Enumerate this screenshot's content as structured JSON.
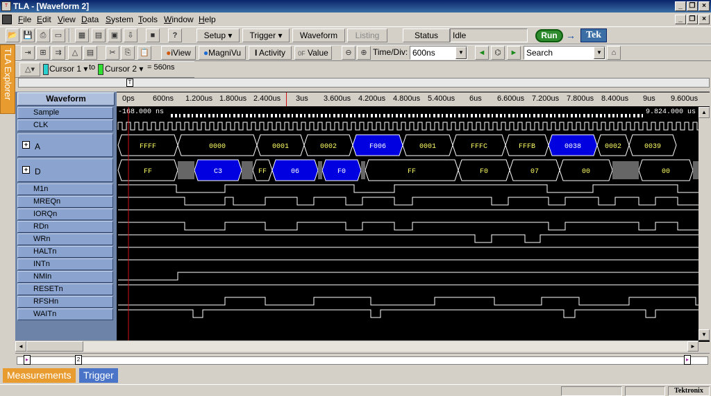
{
  "window": {
    "title": "TLA - [Waveform 2]"
  },
  "menu": [
    {
      "label": "File",
      "u": "F",
      "rest": "ile"
    },
    {
      "label": "Edit",
      "u": "E",
      "rest": "dit"
    },
    {
      "label": "View",
      "u": "V",
      "rest": "iew"
    },
    {
      "label": "Data",
      "u": "D",
      "rest": "ata"
    },
    {
      "label": "System",
      "u": "S",
      "rest": "ystem"
    },
    {
      "label": "Tools",
      "u": "T",
      "rest": "ools"
    },
    {
      "label": "Window",
      "u": "W",
      "rest": "indow"
    },
    {
      "label": "Help",
      "u": "H",
      "rest": "elp"
    }
  ],
  "toolbar1": {
    "setup": "Setup",
    "trigger": "Trigger",
    "waveform": "Waveform",
    "listing": "Listing",
    "status_label": "Status",
    "status_value": "Idle",
    "run": "Run",
    "brand": "Tek"
  },
  "toolbar2": {
    "iview": "iView",
    "magnivu": "MagniVu",
    "activity": "Activity",
    "value": "Value",
    "timediv_label": "Time/Div:",
    "timediv_value": "600ns",
    "search_value": "Search"
  },
  "toolbar3": {
    "cursor1": "Cursor 1",
    "to": "to",
    "cursor2": "Cursor 2",
    "delta": "= 560ns"
  },
  "explorer_tab": "TLA Explorer",
  "waveform_header": "Waveform",
  "ruler_ticks": [
    "0ps",
    "600ns",
    "1.200us",
    "1.800us",
    "2.400us",
    "3us",
    "3.600us",
    "4.200us",
    "4.800us",
    "5.400us",
    "6us",
    "6.600us",
    "7.200us",
    "7.800us",
    "8.400us",
    "9us",
    "9.600us"
  ],
  "sample_start": "-168.000 ns",
  "sample_end": "9.824.000 us",
  "signals": [
    "Sample",
    "CLK",
    "A",
    "D",
    "M1n",
    "MREQn",
    "IORQn",
    "RDn",
    "WRn",
    "HALTn",
    "INTn",
    "NMIn",
    "RESETn",
    "RFSHn",
    "WAITn"
  ],
  "bus_a": [
    "FFFF",
    "0000",
    "0001",
    "0002",
    "F006",
    "0001",
    "FFFC",
    "FFFB",
    "0038",
    "0002",
    "0039"
  ],
  "bus_d": [
    "FF",
    "C3",
    "FF",
    "06",
    "F0",
    "FF",
    "F0",
    "07",
    "00",
    "00"
  ],
  "bottom_tabs": {
    "measurements": "Measurements",
    "trigger": "Trigger"
  },
  "statusbar": {
    "brand": "Tektronix"
  },
  "colors": {
    "trace": "#ffffff",
    "bus_text": "#ffff66",
    "highlight": "#0000e0",
    "cursor": "#d01010",
    "accent_tab": "#e89b2e",
    "tab_blue": "#4a74c8"
  }
}
